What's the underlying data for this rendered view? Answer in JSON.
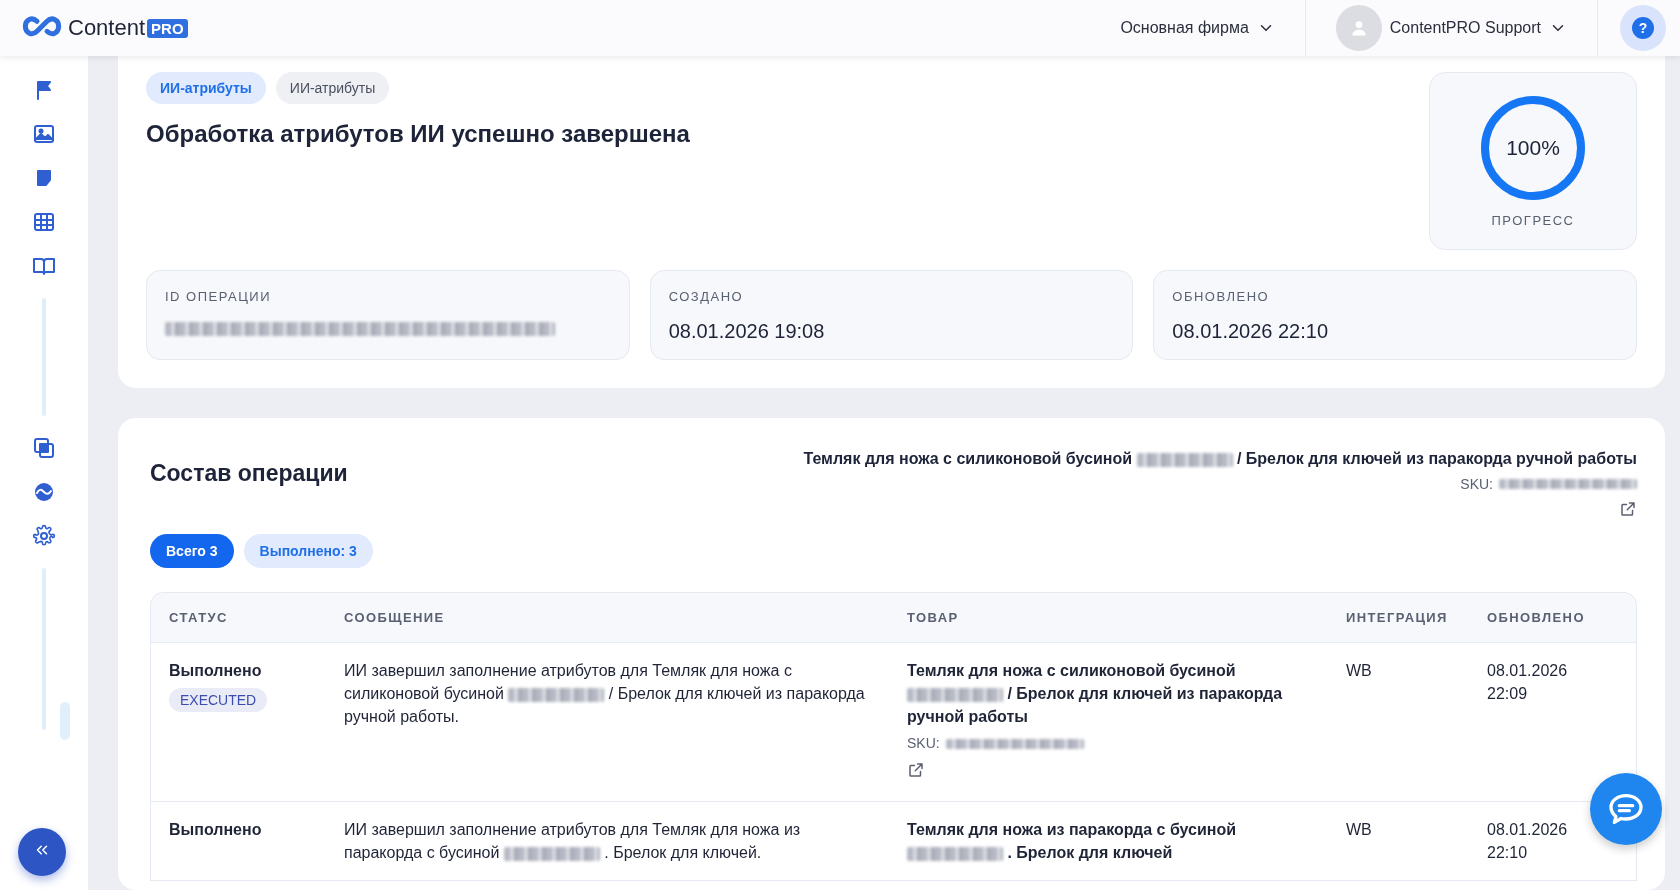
{
  "header": {
    "logo": {
      "text": "Content",
      "badge": "PRO"
    },
    "company": "Основная фирма",
    "user": "ContentPRO Support",
    "help": "?"
  },
  "operation": {
    "tags": [
      {
        "label": "ИИ-атрибуты",
        "selected": true
      },
      {
        "label": "ИИ-атрибуты",
        "selected": false
      }
    ],
    "title": "Обработка атрибутов ИИ успешно завершена",
    "progress": {
      "value": "100%",
      "label": "ПРОГРЕСС",
      "level": 1
    },
    "facts": [
      {
        "label": "ID ОПЕРАЦИИ",
        "kind": "redacted"
      },
      {
        "label": "СОЗДАНО",
        "value": "08.01.2026 19:08"
      },
      {
        "label": "ОБНОВЛЕНО",
        "value": "08.01.2026 22:10"
      }
    ]
  },
  "composition": {
    "title": "Состав операции",
    "product": {
      "name": [
        {
          "kind": "text",
          "text": "Темляк для ножа с силиконовой бусиной"
        },
        {
          "kind": "redacted"
        },
        {
          "kind": "text",
          "text": "/ Брелок для ключей из паракорда ручной работы"
        }
      ],
      "sku_label": "SKU:"
    },
    "filters": [
      {
        "label": "Всего 3",
        "selected": true
      },
      {
        "label": "Выполнено: 3",
        "selected": false
      }
    ],
    "columns": [
      "СТАТУС",
      "СООБЩЕНИЕ",
      "ТОВАР",
      "ИНТЕГРАЦИЯ",
      "ОБНОВЛЕНО"
    ],
    "rows": [
      {
        "status": "Выполнено",
        "badge": "EXECUTED",
        "message": [
          {
            "kind": "text",
            "text": "ИИ завершил заполнение атрибутов для Темляк для ножа с силиконовой бусиной"
          },
          {
            "kind": "redacted"
          },
          {
            "kind": "text",
            "text": "/ Брелок для ключей из паракорда ручной работы."
          }
        ],
        "product": [
          {
            "kind": "text",
            "text": "Темляк для ножа с силиконовой бусиной"
          },
          {
            "kind": "redacted"
          },
          {
            "kind": "text",
            "text": "/ Брелок для ключей из паракорда ручной работы"
          }
        ],
        "sku_label": "SKU:",
        "integration": "WB",
        "updated": "08.01.2026 22:09"
      },
      {
        "status": "Выполнено",
        "message": [
          {
            "kind": "text",
            "text": "ИИ завершил заполнение атрибутов для Темляк для ножа из паракорда с бусиной"
          },
          {
            "kind": "redacted"
          },
          {
            "kind": "text",
            "text": ". Брелок для ключей."
          }
        ],
        "product": [
          {
            "kind": "text",
            "text": "Темляк для ножа из паракорда с бусиной"
          },
          {
            "kind": "redacted"
          },
          {
            "kind": "text",
            "text": ". Брелок для ключей"
          }
        ],
        "integration": "WB",
        "updated": "08.01.2026 22:10"
      }
    ]
  }
}
